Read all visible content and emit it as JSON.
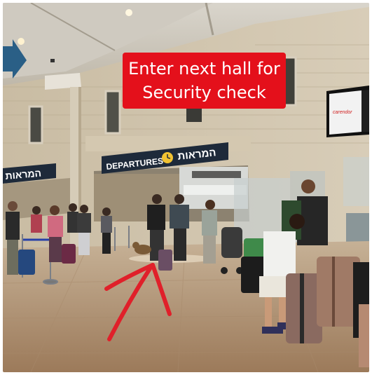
{
  "callout": {
    "line1": "Enter next hall for",
    "line2": "Security check"
  },
  "signs": {
    "main_departures": "DEPARTURES",
    "main_hebrew": "המראות",
    "left_hebrew": "המראות",
    "tv_brand": "carendor"
  },
  "icons": {
    "departure_clock": "clock-icon",
    "arrow_left_edge": "arrow-right-icon",
    "hand_drawn_arrow": "arrow-up-icon"
  },
  "colors": {
    "callout_bg": "#e4101b",
    "sign_bg": "#1e2a3a",
    "arrow_red": "#e0202a",
    "blue_arrow": "#2a5f86",
    "wall": "#cbbfa8",
    "floor": "#b09070"
  }
}
